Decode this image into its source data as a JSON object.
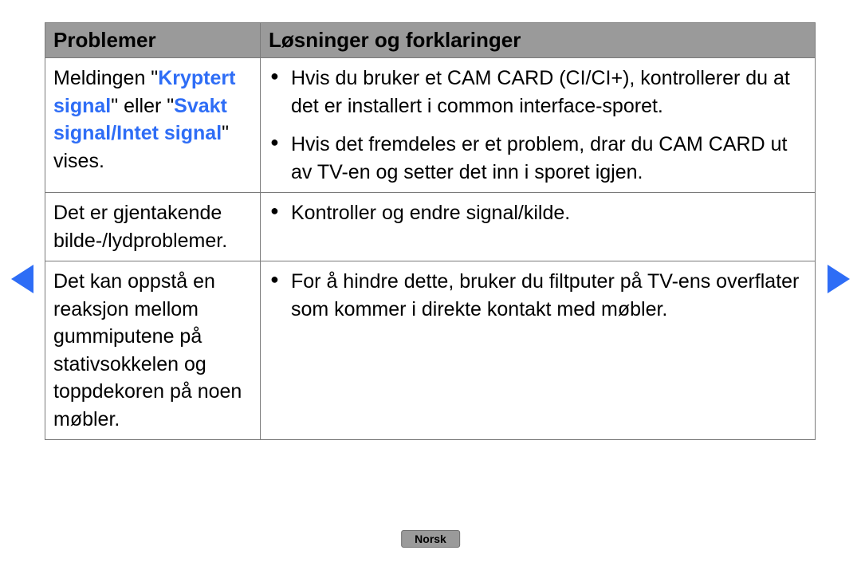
{
  "language_label": "Norsk",
  "table": {
    "headers": {
      "problems": "Problemer",
      "solutions": "Løsninger og forklaringer"
    },
    "rows": [
      {
        "problem_pre": "Meldingen \"",
        "problem_hl1": "Kryptert signal",
        "problem_mid": "\" eller \"",
        "problem_hl2": "Svakt signal/Intet signal",
        "problem_post": "\" vises.",
        "bullets": [
          "Hvis du bruker et CAM CARD (CI/CI+), kontrollerer du at det er installert i common interface-sporet.",
          "Hvis det fremdeles er et problem, drar du CAM CARD ut av TV-en og setter det inn i sporet igjen."
        ]
      },
      {
        "problem_plain": "Det er gjentakende bilde-/lydproblemer.",
        "bullets": [
          "Kontroller og endre signal/kilde."
        ]
      },
      {
        "problem_plain": "Det kan oppstå en reaksjon mellom gummiputene på stativsokkelen og toppdekoren på noen møbler.",
        "bullets": [
          "For å hindre dette, bruker du filtputer på TV-ens overflater som kommer i direkte kontakt med møbler."
        ]
      }
    ]
  }
}
